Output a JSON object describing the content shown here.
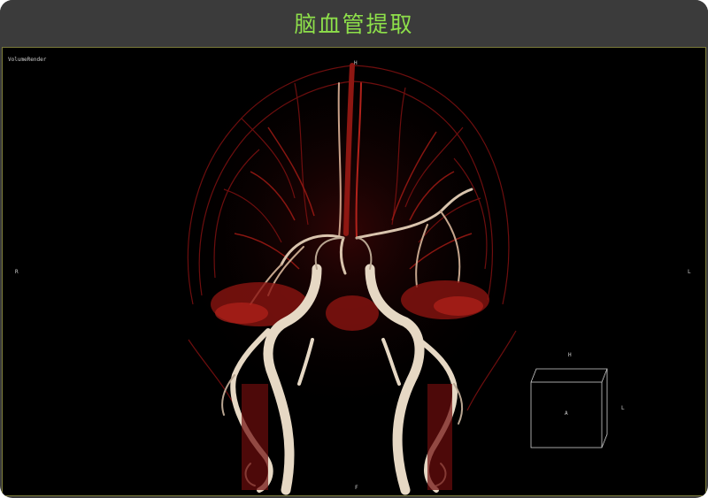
{
  "header": {
    "title": "脑血管提取"
  },
  "viewport": {
    "render_name": "VolumeRender",
    "orientation": {
      "top": "H",
      "left": "R",
      "right": "L",
      "bottom": "F"
    },
    "orientation_cube": {
      "top": "H",
      "face": "A",
      "right": "L"
    }
  },
  "colors": {
    "title": "#8ee04a",
    "frame": "#3b3b3b",
    "vessel_dark": "#6e0d0d",
    "vessel_red": "#b3221b",
    "vessel_bone": "#e6d8c4"
  }
}
